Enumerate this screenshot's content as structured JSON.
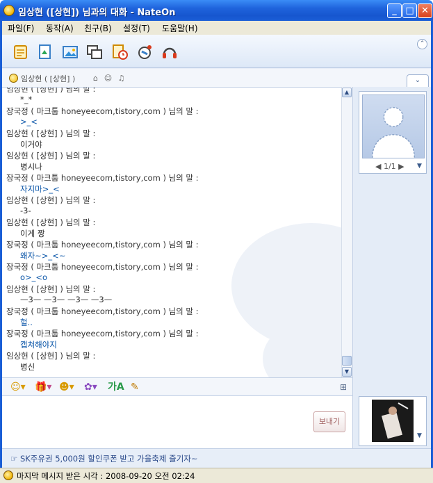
{
  "window": {
    "title": "임상현 ([상현]) 님과의 대화  - NateOn",
    "minimize": "_",
    "maximize": "□",
    "close": "✕"
  },
  "menu": [
    "파일(F)",
    "동작(A)",
    "친구(B)",
    "설정(T)",
    "도움말(H)"
  ],
  "toolbar_icons": [
    "notepad-icon",
    "file-send-icon",
    "photo-icon",
    "window-icon",
    "alarm-icon",
    "call-icon",
    "headset-icon"
  ],
  "collapse_button": "⌃",
  "info": {
    "name": "임상현 ( [상현] )",
    "icons": [
      "home-icon",
      "people-icon",
      "music-icon"
    ],
    "tab": "⌄"
  },
  "chat": [
    {
      "type": "header",
      "text": "임상현 ( [상현] ) 님의 말 :"
    },
    {
      "type": "msg",
      "who": "me",
      "text": "*_*"
    },
    {
      "type": "header",
      "text": "장국정 ( 마크툽 honeyeecom,tistory,com ) 님의 말 :"
    },
    {
      "type": "msg",
      "who": "other",
      "text": ">_<"
    },
    {
      "type": "header",
      "text": "임상현 ( [상현] ) 님의 말 :"
    },
    {
      "type": "msg",
      "who": "me",
      "text": "이거야"
    },
    {
      "type": "header",
      "text": "임상현 ( [상현] ) 님의 말 :"
    },
    {
      "type": "msg",
      "who": "me",
      "text": "병시나"
    },
    {
      "type": "header",
      "text": "장국정 ( 마크툽 honeyeecom,tistory,com ) 님의 말 :"
    },
    {
      "type": "msg",
      "who": "other",
      "text": "자지마>_<"
    },
    {
      "type": "header",
      "text": "임상현 ( [상현] ) 님의 말 :"
    },
    {
      "type": "msg",
      "who": "me",
      "text": "-3-"
    },
    {
      "type": "header",
      "text": "임상현 ( [상현] ) 님의 말 :"
    },
    {
      "type": "msg",
      "who": "me",
      "text": "이게 짱"
    },
    {
      "type": "header",
      "text": "장국정 ( 마크툽 honeyeecom,tistory,com ) 님의 말 :"
    },
    {
      "type": "msg",
      "who": "other",
      "text": "왜자~>_<~"
    },
    {
      "type": "header",
      "text": "장국정 ( 마크툽 honeyeecom,tistory,com ) 님의 말 :"
    },
    {
      "type": "msg",
      "who": "other",
      "text": "o>_<o"
    },
    {
      "type": "header",
      "text": "임상현 ( [상현] ) 님의 말 :"
    },
    {
      "type": "msg",
      "who": "me",
      "text": "—3—  —3—  —3—  —3—"
    },
    {
      "type": "header",
      "text": "장국정 ( 마크툽 honeyeecom,tistory,com ) 님의 말 :"
    },
    {
      "type": "msg",
      "who": "other",
      "text": "헐.."
    },
    {
      "type": "header",
      "text": "장국정 ( 마크툽 honeyeecom,tistory,com ) 님의 말 :"
    },
    {
      "type": "msg",
      "who": "other",
      "text": "캡쳐해야지"
    },
    {
      "type": "header",
      "text": "임상현 ( [상현] ) 님의 말 :"
    },
    {
      "type": "msg",
      "who": "me",
      "text": "병신"
    }
  ],
  "input_toolbar_icons": [
    "emoticon-icon",
    "gift-icon",
    "character-icon",
    "sticker-icon",
    "font-icon",
    "pen-icon"
  ],
  "send_button": "보내기",
  "avatar": {
    "pager": "◀ 1/1 ▶",
    "menu": "▼"
  },
  "photo_menu": "▼",
  "ad": "☞ SK주유권 5,000원 할인쿠폰 받고 가을축제 즐기자~",
  "status": "마지막 메시지 받은 시각 : 2008-09-20 오전 02:24",
  "colors": {
    "titlebar": "#1f63dc",
    "msg_other": "#0a55a8",
    "msg_me": "#2a2a2a",
    "ad_text": "#2b4a8a"
  }
}
